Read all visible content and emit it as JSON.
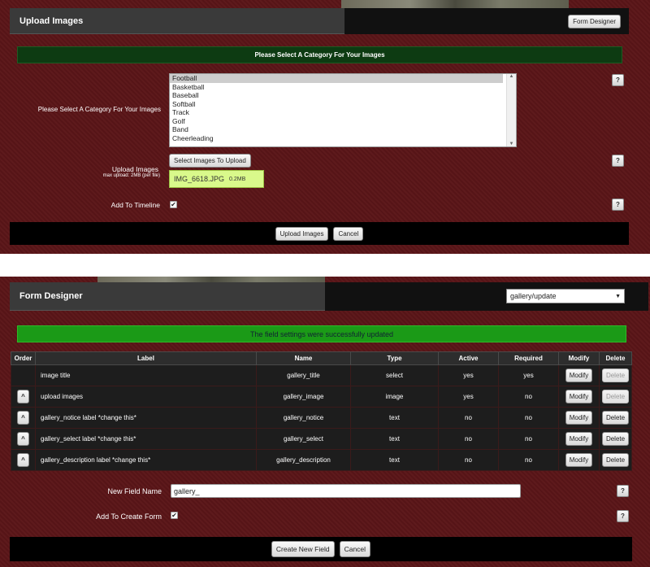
{
  "upload_panel": {
    "title": "Upload Images",
    "form_designer_button": "Form Designer",
    "banner": "Please Select A Category For Your Images",
    "banner_color": "#0d3b12",
    "category_label": "Please Select A Category For Your Images",
    "categories": [
      "Football",
      "Basketball",
      "Baseball",
      "Softball",
      "Track",
      "Golf",
      "Band",
      "Cheerleading"
    ],
    "selected_category": "Football",
    "upload_label": "Upload Images",
    "upload_sublabel": "max upload: 2MB (per file)",
    "select_images_button": "Select Images To Upload",
    "file_name": "IMG_6618.JPG",
    "file_size": "0.2MB",
    "timeline_label": "Add To Timeline",
    "timeline_checked": true,
    "upload_button": "Upload Images",
    "cancel_button": "Cancel",
    "help": "?"
  },
  "designer_panel": {
    "title": "Form Designer",
    "form_select_value": "gallery/update",
    "success_message": "The field settings were successfully updated",
    "success_color": "#1b9a17",
    "columns": [
      "Order",
      "Label",
      "Name",
      "Type",
      "Active",
      "Required",
      "Modify",
      "Delete"
    ],
    "rows": [
      {
        "order": "",
        "label": "image title",
        "name": "gallery_title",
        "type": "select",
        "active": "yes",
        "required": "yes",
        "modify": "Modify",
        "delete": "Delete",
        "delete_enabled": false
      },
      {
        "order": "^",
        "label": "upload images",
        "name": "gallery_image",
        "type": "image",
        "active": "yes",
        "required": "no",
        "modify": "Modify",
        "delete": "Delete",
        "delete_enabled": false
      },
      {
        "order": "^",
        "label": "gallery_notice label *change this*",
        "name": "gallery_notice",
        "type": "text",
        "active": "no",
        "required": "no",
        "modify": "Modify",
        "delete": "Delete",
        "delete_enabled": true
      },
      {
        "order": "^",
        "label": "gallery_select label *change this*",
        "name": "gallery_select",
        "type": "text",
        "active": "no",
        "required": "no",
        "modify": "Modify",
        "delete": "Delete",
        "delete_enabled": true
      },
      {
        "order": "^",
        "label": "gallery_description label *change this*",
        "name": "gallery_description",
        "type": "text",
        "active": "no",
        "required": "no",
        "modify": "Modify",
        "delete": "Delete",
        "delete_enabled": true
      }
    ],
    "new_field_label": "New Field Name",
    "new_field_value": "gallery_",
    "create_form_label": "Add To Create Form",
    "create_form_checked": true,
    "create_button": "Create New Field",
    "cancel_button": "Cancel",
    "help": "?"
  }
}
